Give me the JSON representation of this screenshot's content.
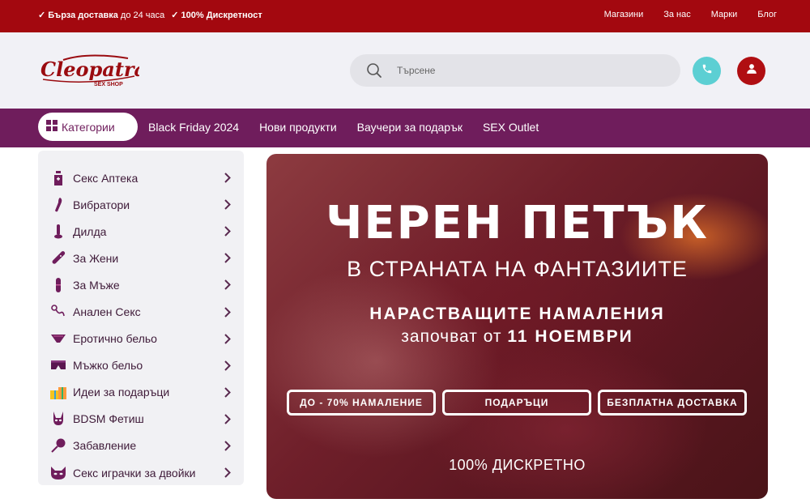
{
  "topbar": {
    "perk1_bold": "✓ Бърза доставка",
    "perk1_rest": "до 24 часа",
    "perk2": "✓ 100% Дискретност",
    "links": [
      "Магазини",
      "За нас",
      "Марки",
      "Блог"
    ]
  },
  "header": {
    "logo_text": "Cleopatra",
    "logo_sub": "SEX SHOP",
    "search_placeholder": "Търсене",
    "phone_icon": "phone-icon",
    "user_icon": "user-icon"
  },
  "colors": {
    "topbar": "#a3080f",
    "nav": "#6f1d5c",
    "phone": "#5ccfd3",
    "user": "#b00e12"
  },
  "nav": {
    "categories_label": "Категории",
    "items": [
      "Black Friday 2024",
      "Нови продукти",
      "Ваучери за подарък",
      "SEX Outlet"
    ]
  },
  "sidebar": {
    "items": [
      {
        "label": "Секс Аптека",
        "icon": "pharmacy-bottle-icon"
      },
      {
        "label": "Вибратори",
        "icon": "vibrator-icon"
      },
      {
        "label": "Дилда",
        "icon": "dildo-icon"
      },
      {
        "label": "За Жени",
        "icon": "women-toy-icon"
      },
      {
        "label": "За Мъже",
        "icon": "men-toy-icon"
      },
      {
        "label": "Анален Секс",
        "icon": "anal-toy-icon"
      },
      {
        "label": "Еротично бельо",
        "icon": "lingerie-icon"
      },
      {
        "label": "Мъжко бельо",
        "icon": "men-underwear-icon"
      },
      {
        "label": "Идеи за подаръци",
        "icon": "gift-icon"
      },
      {
        "label": "BDSM Фетиш",
        "icon": "bdsm-mask-icon"
      },
      {
        "label": "Забавление",
        "icon": "fun-toy-icon"
      },
      {
        "label": "Секс играчки за двойки",
        "icon": "couples-mask-icon"
      }
    ]
  },
  "banner": {
    "title": "ЧЕРЕН ПЕТЪК",
    "subtitle": "В СТРАНАТА НА ФАНТАЗИИТЕ",
    "promo_line1": "НАРАСТВАЩИТЕ НАМАЛЕНИЯ",
    "promo_line2_prefix": "започват от",
    "promo_line2_bold": "11 НОЕМВРИ",
    "pills": [
      "ДО - 70% НАМАЛЕНИЕ",
      "ПОДАРЪЦИ",
      "БЕЗПЛАТНА ДОСТАВКА"
    ],
    "footer": "100% ДИСКРЕТНО"
  }
}
